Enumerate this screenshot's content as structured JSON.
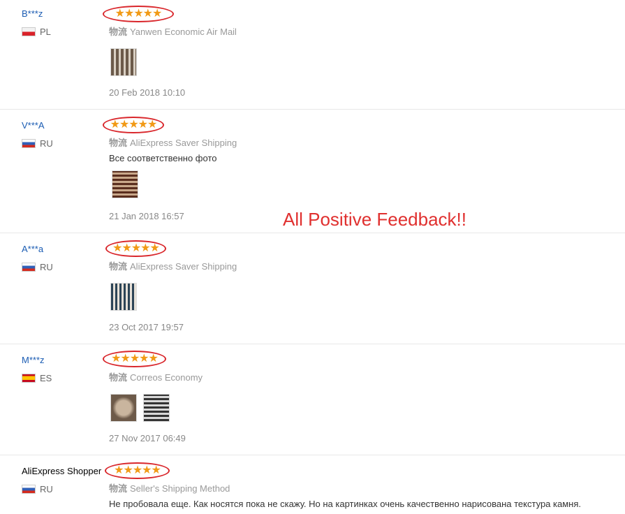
{
  "overlay": {
    "text": "All Positive Feedback!!"
  },
  "shipping_prefix": "物流",
  "stars_glyph": "★★★★★",
  "rating_max": 5,
  "reviews": [
    {
      "user": "B***z",
      "country": "PL",
      "rating": 5,
      "shipping": "Yanwen Economic Air Mail",
      "comment": "",
      "date": "20 Feb 2018 10:10",
      "photo_count": 1
    },
    {
      "user": "V***A",
      "country": "RU",
      "rating": 5,
      "shipping": "AliExpress Saver Shipping",
      "comment": "Все соответственно фото",
      "date": "21 Jan 2018 16:57",
      "photo_count": 1
    },
    {
      "user": "A***a",
      "country": "RU",
      "rating": 5,
      "shipping": "AliExpress Saver Shipping",
      "comment": "",
      "date": "23 Oct 2017 19:57",
      "photo_count": 1
    },
    {
      "user": "M***z",
      "country": "ES",
      "rating": 5,
      "shipping": "Correos Economy",
      "comment": "",
      "date": "27 Nov 2017 06:49",
      "photo_count": 2
    },
    {
      "user": "AliExpress Shopper",
      "country": "RU",
      "rating": 5,
      "shipping": "Seller's Shipping Method",
      "comment": "Не пробовала еще. Как носятся пока не скажу. Но на картинках очень качественно нарисована текстура камня.",
      "date": "",
      "photo_count": 0
    }
  ]
}
